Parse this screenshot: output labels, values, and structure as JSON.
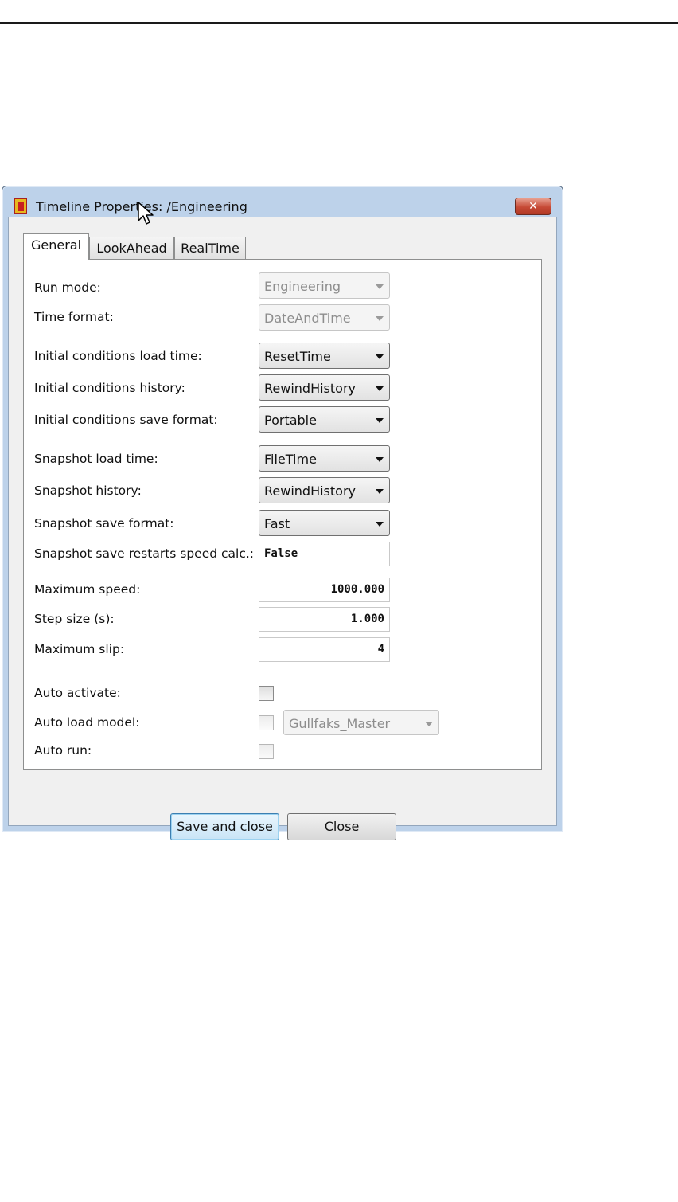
{
  "window": {
    "title": "Timeline Properties: /Engineering",
    "close_label": "✕"
  },
  "tabs": [
    {
      "label": "General",
      "active": true
    },
    {
      "label": "LookAhead",
      "active": false
    },
    {
      "label": "RealTime",
      "active": false
    }
  ],
  "general": {
    "run_mode": {
      "label": "Run mode:",
      "value": "Engineering",
      "enabled": false
    },
    "time_format": {
      "label": "Time format:",
      "value": "DateAndTime",
      "enabled": false
    },
    "ic_load_time": {
      "label": "Initial conditions load time:",
      "value": "ResetTime"
    },
    "ic_history": {
      "label": "Initial conditions history:",
      "value": "RewindHistory"
    },
    "ic_save_format": {
      "label": "Initial conditions save format:",
      "value": "Portable"
    },
    "snap_load_time": {
      "label": "Snapshot load time:",
      "value": "FileTime"
    },
    "snap_history": {
      "label": "Snapshot history:",
      "value": "RewindHistory"
    },
    "snap_save_format": {
      "label": "Snapshot save format:",
      "value": "Fast"
    },
    "snap_restarts_speed": {
      "label": "Snapshot save restarts speed calc.:",
      "value": "False"
    },
    "max_speed": {
      "label": "Maximum speed:",
      "value": "1000.000"
    },
    "step_size": {
      "label": "Step size (s):",
      "value": "1.000"
    },
    "max_slip": {
      "label": "Maximum slip:",
      "value": "4"
    },
    "auto_activate": {
      "label": "Auto activate:",
      "checked": false
    },
    "auto_load_model": {
      "label": "Auto load model:",
      "checked": false,
      "model": "Gullfaks_Master"
    },
    "auto_run": {
      "label": "Auto run:",
      "checked": false
    }
  },
  "buttons": {
    "save": "Save and close",
    "close": "Close"
  },
  "colors": {
    "window_frame": "#bdd2ea",
    "close_button": "#c64a36",
    "default_button": "#c8e4f6"
  }
}
